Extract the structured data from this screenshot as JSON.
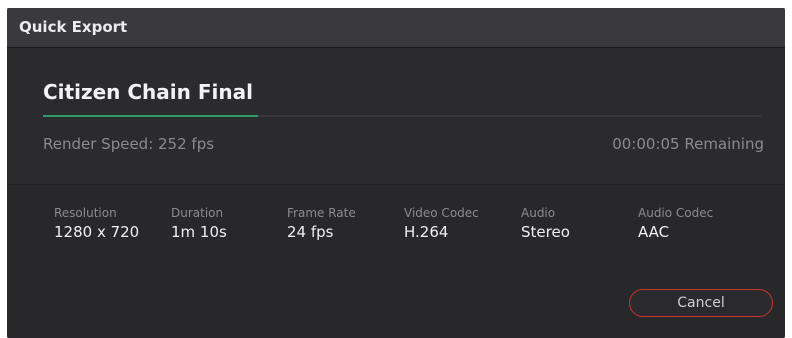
{
  "window": {
    "title": "Quick Export"
  },
  "job": {
    "name": "Citizen Chain Final",
    "progress": 0.3,
    "render_speed": "Render Speed: 252 fps",
    "remaining": "00:00:05 Remaining"
  },
  "info": [
    {
      "label": "Resolution",
      "value": "1280 x 720"
    },
    {
      "label": "Duration",
      "value": "1m 10s"
    },
    {
      "label": "Frame Rate",
      "value": "24 fps"
    },
    {
      "label": "Video Codec",
      "value": "H.264"
    },
    {
      "label": "Audio",
      "value": "Stereo"
    },
    {
      "label": "Audio Codec",
      "value": "AAC"
    }
  ],
  "buttons": {
    "cancel_label": "Cancel"
  },
  "colors": {
    "progress": "#2f9a6a",
    "cancel_border": "#c8332b"
  }
}
